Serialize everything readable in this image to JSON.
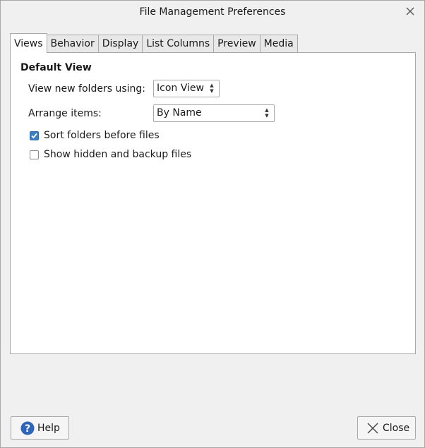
{
  "window": {
    "title": "File Management Preferences"
  },
  "tabs": [
    {
      "label": "Views",
      "active": true
    },
    {
      "label": "Behavior",
      "active": false
    },
    {
      "label": "Display",
      "active": false
    },
    {
      "label": "List Columns",
      "active": false
    },
    {
      "label": "Preview",
      "active": false
    },
    {
      "label": "Media",
      "active": false
    }
  ],
  "views": {
    "section_title": "Default View",
    "view_new_folders": {
      "label": "View new folders using:",
      "value": "Icon View"
    },
    "arrange_items": {
      "label": "Arrange items:",
      "value": "By Name"
    },
    "sort_folders": {
      "label": "Sort folders before files",
      "checked": true
    },
    "show_hidden": {
      "label": "Show hidden and backup files",
      "checked": false
    }
  },
  "buttons": {
    "help": "Help",
    "close": "Close"
  },
  "icons": {
    "window_close": "close-icon",
    "help": "help-icon",
    "close": "close-x-icon"
  },
  "colors": {
    "checkbox_checked": "#3d7fc4",
    "help_icon": "#2f65b8"
  }
}
